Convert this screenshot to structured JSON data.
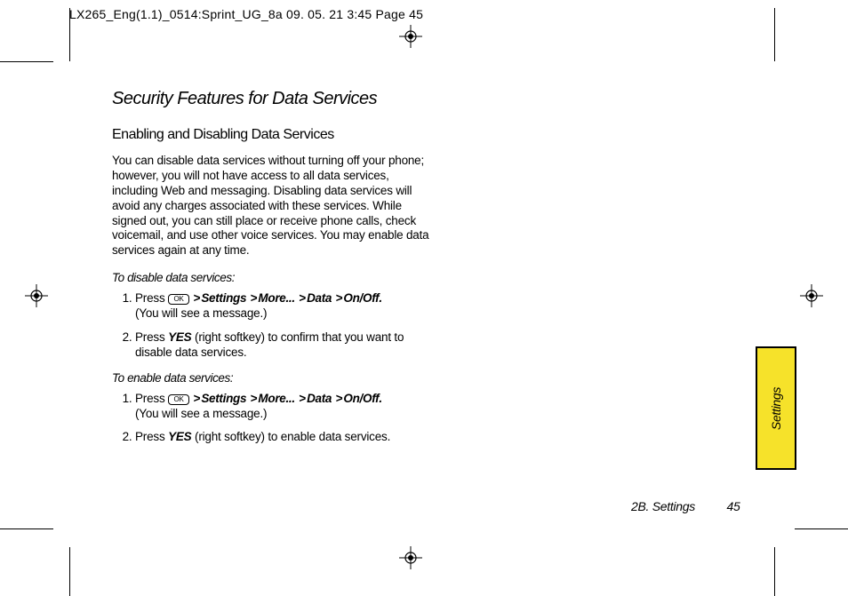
{
  "slugline": "LX265_Eng(1.1)_0514:Sprint_UG_8a  09. 05. 21     3:45  Page 45",
  "section_title": "Security Features for Data Services",
  "subheading": "Enabling and Disabling Data Services",
  "intro": "You can disable data services without turning off your phone; however, you will not have access to all data services, including Web and messaging. Disabling data services will avoid any charges associated with these services. While signed out, you can still place or receive phone calls, check voicemail, and use other voice services. You may enable data services again at any time.",
  "proc1_head": "To disable data services:",
  "proc1_step1_press": "Press ",
  "key_label": "OK",
  "nav_settings": "Settings",
  "nav_more": "More...",
  "nav_data": "Data",
  "nav_onoff": "On/Off.",
  "proc1_step1_note": "(You will see a message.)",
  "proc1_step2_a": "Press ",
  "yes": "YES",
  "proc1_step2_b": " (right softkey) to confirm that you want to disable data services.",
  "proc2_head": "To enable data services:",
  "proc2_step1_note": "(You will see a message.)",
  "proc2_step2_b": " (right softkey) to enable data services.",
  "tab_label": "Settings",
  "footer_section": "2B. Settings",
  "footer_page": "45",
  "gt": ">"
}
